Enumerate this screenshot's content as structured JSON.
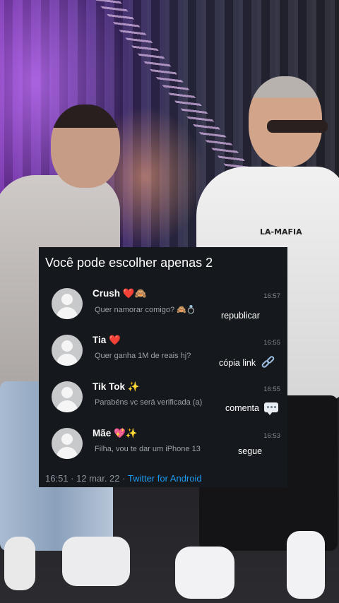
{
  "background": {
    "shirt_logo": "LA-MAFIA"
  },
  "card": {
    "title": "Você pode escolher apenas 2",
    "chats": [
      {
        "name": "Crush ❤️🙈",
        "message": "Quer namorar comigo? 🙈💍",
        "time": "16:57",
        "action": "republicar",
        "action_icon": ""
      },
      {
        "name": "Tia ❤️",
        "message": "Quer ganha 1M de reais hj?",
        "time": "16:55",
        "action": "cópia link",
        "action_icon": "link-icon"
      },
      {
        "name": "Tik Tok ✨",
        "message": "Parabéns vc será verificada (a)",
        "time": "16:55",
        "action": "comenta",
        "action_icon": "comment-bubble-icon"
      },
      {
        "name": "Mãe 💖✨",
        "message": "Filha, vou te dar um iPhone 13",
        "time": "16:53",
        "action": "segue",
        "action_icon": ""
      }
    ],
    "footer": {
      "time_date": "16:51 · 12 mar. 22 ·",
      "source": "Twitter for Android"
    }
  },
  "colors": {
    "card_bg": "#15181c",
    "link_blue": "#1d9bf0",
    "muted_text": "#9aa2ab"
  }
}
